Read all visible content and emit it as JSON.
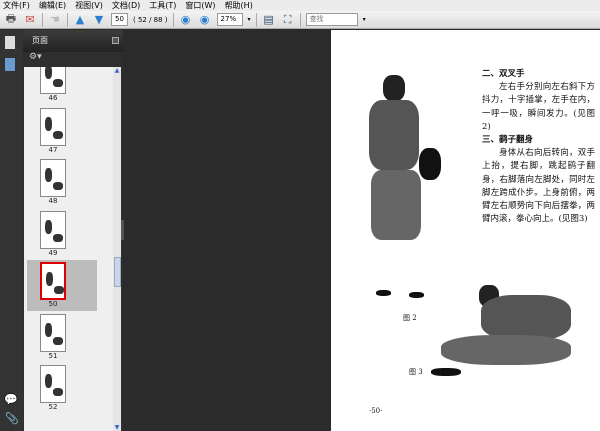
{
  "menu": [
    "文件(F)",
    "编辑(E)",
    "视图(V)",
    "文档(D)",
    "工具(T)",
    "窗口(W)",
    "帮助(H)"
  ],
  "toolbar": {
    "page_input": "50",
    "page_count": "( 52 / 88 )",
    "zoom": "27%",
    "search_placeholder": "查找"
  },
  "panel": {
    "title": "页面"
  },
  "thumbnails": [
    {
      "n": "46"
    },
    {
      "n": "47"
    },
    {
      "n": "48"
    },
    {
      "n": "49"
    },
    {
      "n": "50",
      "selected": true
    },
    {
      "n": "51"
    },
    {
      "n": "52"
    }
  ],
  "page": {
    "h2": "二、双叉手",
    "p2": "左右手分别向左右斜下方抖力，十字插掌，左手在内，一呼一吸，瞬间发力。(见图2)",
    "h3": "三、鹞子翻身",
    "p3": "身体从右向后转向，双手上抬，提右脚，跳起鹞子翻身，右脚落向左脚处，同时左脚左跨成仆步。上身前俯，两臂左右顺势向下向后摆拳，两臂内滚，拳心向上。(见图3)",
    "fig2": "图 2",
    "fig3": "图 3",
    "pagenum": "·50·"
  },
  "colors": {
    "selection": "#dd0000",
    "toolbar": "#e4e4e4",
    "doc_bg": "#2b2b2b"
  }
}
